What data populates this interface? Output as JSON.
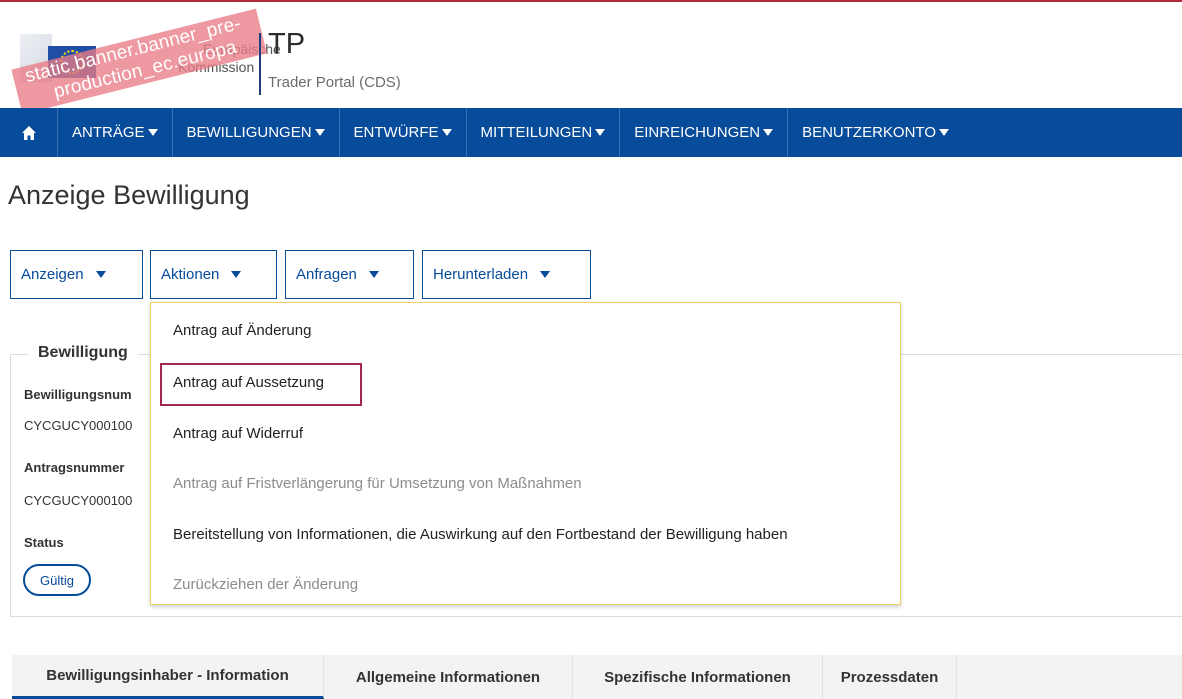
{
  "header": {
    "logo_stamp_line1": "static.banner.banner_pre-",
    "logo_stamp_line2": "production_ec.europa",
    "org_line1": "Europäische",
    "org_line2": "Kommission",
    "app_abbr": "TP",
    "app_name": "Trader Portal (CDS)"
  },
  "nav": {
    "home_icon": "home-icon",
    "items": [
      {
        "label": "ANTRÄGE"
      },
      {
        "label": "BEWILLIGUNGEN"
      },
      {
        "label": "ENTWÜRFE"
      },
      {
        "label": "MITTEILUNGEN"
      },
      {
        "label": "EINREICHUNGEN"
      },
      {
        "label": "BENUTZERKONTO"
      }
    ]
  },
  "page": {
    "title": "Anzeige Bewilligung"
  },
  "actions": {
    "buttons": [
      {
        "label": "Anzeigen"
      },
      {
        "label": "Aktionen"
      },
      {
        "label": "Anfragen"
      },
      {
        "label": "Herunterladen"
      }
    ]
  },
  "dropdown": {
    "items": [
      {
        "label": "Antrag auf Änderung",
        "enabled": true
      },
      {
        "label": "Antrag auf Aussetzung",
        "enabled": true,
        "highlighted": true
      },
      {
        "label": "Antrag auf Widerruf",
        "enabled": true
      },
      {
        "label": "Antrag auf Fristverlängerung für Umsetzung von Maßnahmen",
        "enabled": false
      },
      {
        "label": "Bereitstellung von Informationen, die Auswirkung auf den Fortbestand der Bewilligung haben",
        "enabled": true
      },
      {
        "label": "Zurückziehen der Änderung",
        "enabled": false
      }
    ]
  },
  "panel": {
    "legend": "Bewilligung",
    "auth_number_label": "Bewilligungsnum",
    "auth_number_value": "CYCGUCY000100",
    "application_number_label": "Antragsnummer",
    "application_number_value": "CYCGUCY000100",
    "status_label": "Status",
    "status_value": "Gültig"
  },
  "tabs": [
    {
      "label": "Bewilligungsinhaber - Information",
      "active": true
    },
    {
      "label": "Allgemeine Informationen"
    },
    {
      "label": "Spezifische Informationen"
    },
    {
      "label": "Prozessdaten"
    }
  ],
  "colors": {
    "primary": "#074b9b",
    "highlight_border": "#a3284f",
    "dropdown_border": "#f0cf5e"
  }
}
